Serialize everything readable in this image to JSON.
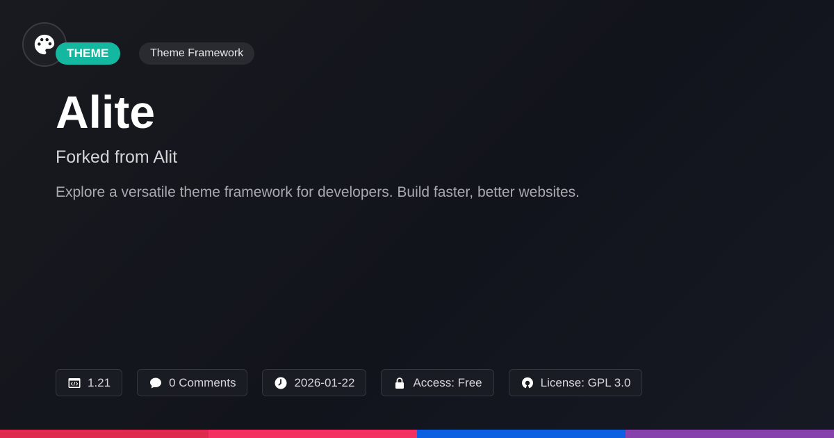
{
  "header": {
    "logo_icon": "palette-icon",
    "type_badge": "THEME",
    "category_badge": "Theme Framework"
  },
  "main": {
    "title": "Alite",
    "subtitle": "Forked from Alit",
    "description": "Explore a versatile theme framework for developers. Build faster, better websites."
  },
  "meta": {
    "version": {
      "icon": "code-window-icon",
      "label": "1.21"
    },
    "comments": {
      "icon": "speech-bubble-icon",
      "label": "0 Comments"
    },
    "date": {
      "icon": "clock-icon",
      "label": "2026-01-22"
    },
    "access": {
      "icon": "lock-icon",
      "label": "Access: Free"
    },
    "license": {
      "icon": "open-source-icon",
      "label": "License: GPL 3.0"
    }
  },
  "colors": {
    "accent_teal": "#14b8a0",
    "bar_red": "#e0294f",
    "bar_pink": "#f43062",
    "bar_blue": "#0b5fe0",
    "bar_purple": "#8741ad"
  }
}
